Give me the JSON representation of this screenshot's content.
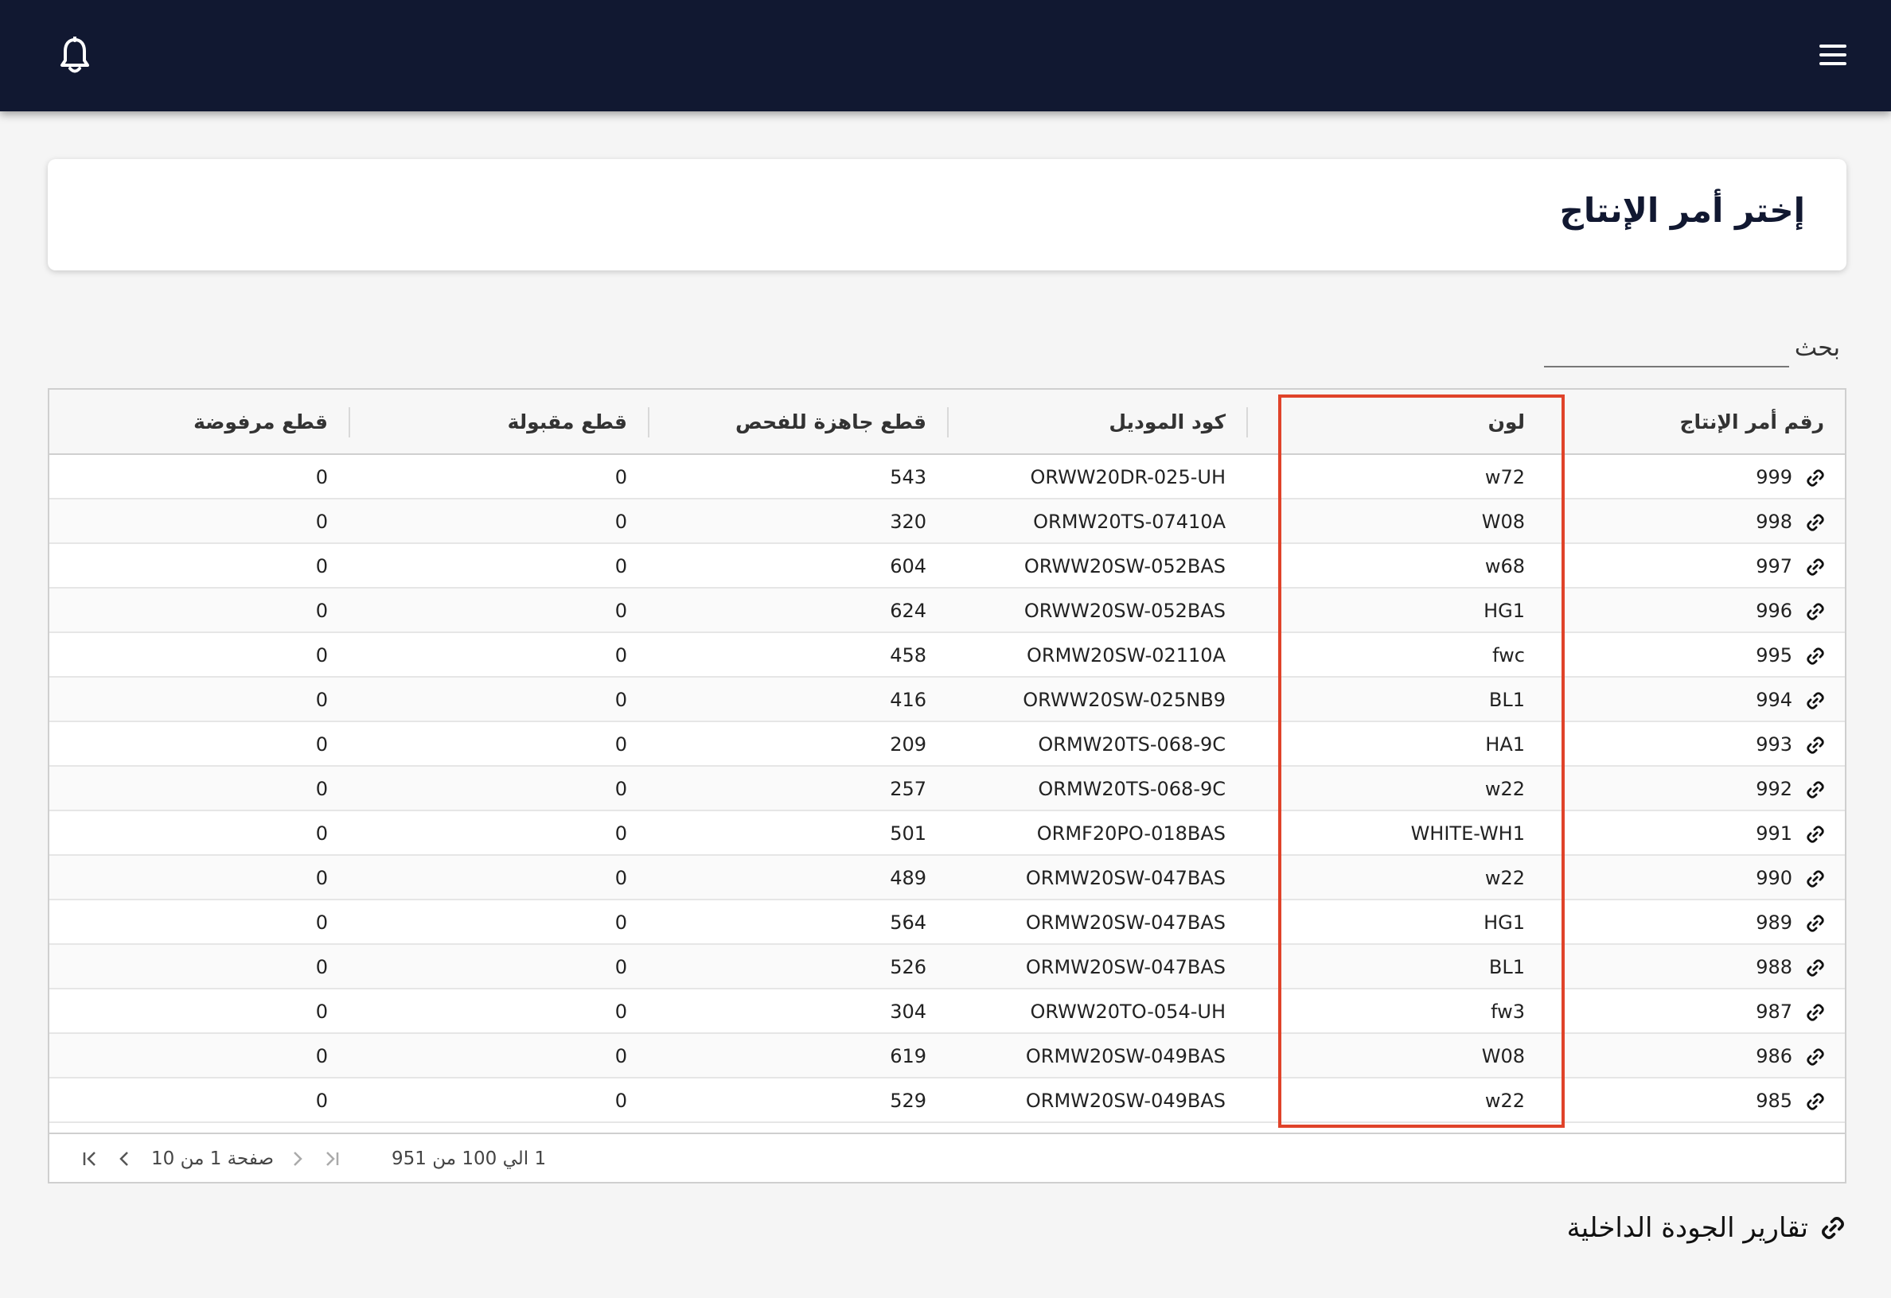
{
  "header": {
    "menu_icon": "hamburger-menu-icon",
    "notifications_icon": "bell-icon"
  },
  "page": {
    "title": "إختر أمر الإنتاج"
  },
  "search": {
    "label": "بحث",
    "value": "",
    "placeholder": ""
  },
  "table": {
    "columns": [
      {
        "key": "order_no",
        "label": "رقم أمر الإنتاج"
      },
      {
        "key": "color",
        "label": "لون"
      },
      {
        "key": "model_code",
        "label": "كود الموديل"
      },
      {
        "key": "ready_pieces",
        "label": "قطع جاهزة للفحص"
      },
      {
        "key": "accepted_pieces",
        "label": "قطع مقبولة"
      },
      {
        "key": "rejected_pieces",
        "label": "قطع مرفوضة"
      }
    ],
    "rows": [
      {
        "order_no": "999",
        "color": "w72",
        "model_code": "ORWW20DR-025-UH",
        "ready_pieces": "543",
        "accepted_pieces": "0",
        "rejected_pieces": "0"
      },
      {
        "order_no": "998",
        "color": "W08",
        "model_code": "ORMW20TS-07410A",
        "ready_pieces": "320",
        "accepted_pieces": "0",
        "rejected_pieces": "0"
      },
      {
        "order_no": "997",
        "color": "w68",
        "model_code": "ORWW20SW-052BAS",
        "ready_pieces": "604",
        "accepted_pieces": "0",
        "rejected_pieces": "0"
      },
      {
        "order_no": "996",
        "color": "HG1",
        "model_code": "ORWW20SW-052BAS",
        "ready_pieces": "624",
        "accepted_pieces": "0",
        "rejected_pieces": "0"
      },
      {
        "order_no": "995",
        "color": "fwc",
        "model_code": "ORMW20SW-02110A",
        "ready_pieces": "458",
        "accepted_pieces": "0",
        "rejected_pieces": "0"
      },
      {
        "order_no": "994",
        "color": "BL1",
        "model_code": "ORWW20SW-025NB9",
        "ready_pieces": "416",
        "accepted_pieces": "0",
        "rejected_pieces": "0"
      },
      {
        "order_no": "993",
        "color": "HA1",
        "model_code": "ORMW20TS-068-9C",
        "ready_pieces": "209",
        "accepted_pieces": "0",
        "rejected_pieces": "0"
      },
      {
        "order_no": "992",
        "color": "w22",
        "model_code": "ORMW20TS-068-9C",
        "ready_pieces": "257",
        "accepted_pieces": "0",
        "rejected_pieces": "0"
      },
      {
        "order_no": "991",
        "color": "WHITE-WH1",
        "model_code": "ORMF20PO-018BAS",
        "ready_pieces": "501",
        "accepted_pieces": "0",
        "rejected_pieces": "0"
      },
      {
        "order_no": "990",
        "color": "w22",
        "model_code": "ORMW20SW-047BAS",
        "ready_pieces": "489",
        "accepted_pieces": "0",
        "rejected_pieces": "0"
      },
      {
        "order_no": "989",
        "color": "HG1",
        "model_code": "ORMW20SW-047BAS",
        "ready_pieces": "564",
        "accepted_pieces": "0",
        "rejected_pieces": "0"
      },
      {
        "order_no": "988",
        "color": "BL1",
        "model_code": "ORMW20SW-047BAS",
        "ready_pieces": "526",
        "accepted_pieces": "0",
        "rejected_pieces": "0"
      },
      {
        "order_no": "987",
        "color": "fw3",
        "model_code": "ORWW20TO-054-UH",
        "ready_pieces": "304",
        "accepted_pieces": "0",
        "rejected_pieces": "0"
      },
      {
        "order_no": "986",
        "color": "W08",
        "model_code": "ORMW20SW-049BAS",
        "ready_pieces": "619",
        "accepted_pieces": "0",
        "rejected_pieces": "0"
      },
      {
        "order_no": "985",
        "color": "w22",
        "model_code": "ORMW20SW-049BAS",
        "ready_pieces": "529",
        "accepted_pieces": "0",
        "rejected_pieces": "0"
      }
    ],
    "row_link_icon": "link-icon"
  },
  "pagination": {
    "range_text": "1 الي 100 من 951",
    "page_text": "صفحة 1 من 10",
    "first_icon": "first-page-icon",
    "prev_icon": "previous-page-icon",
    "next_icon": "next-page-icon",
    "last_icon": "last-page-icon"
  },
  "footer_link": {
    "label": "تقارير الجودة الداخلية",
    "icon": "link-icon"
  },
  "colors": {
    "topbar": "#111831",
    "highlight": "#e0432a",
    "background": "#f5f5f5"
  }
}
